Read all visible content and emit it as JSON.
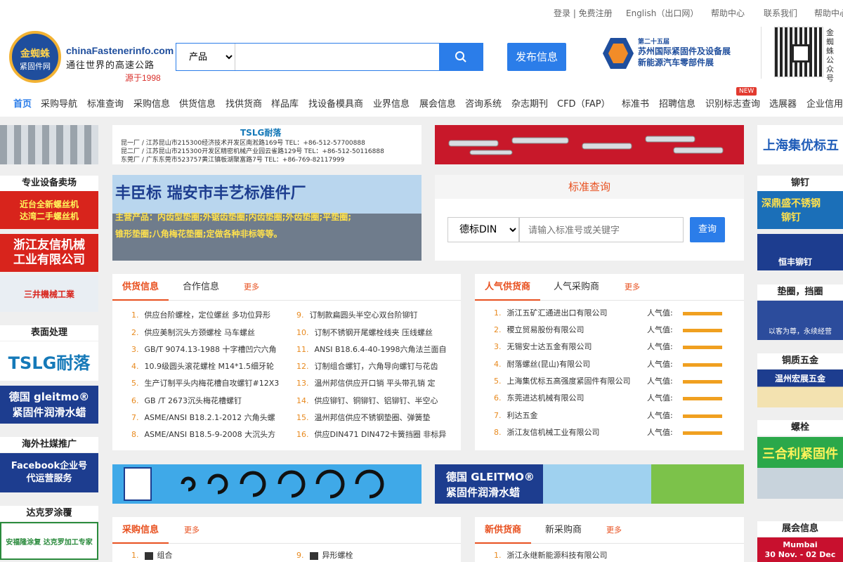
{
  "topbar": {
    "login": "登录 | 免费注册",
    "english": "English（出口网）",
    "help": "帮助中心",
    "contact": "联系我们",
    "help2": "帮助中心"
  },
  "logo": {
    "cn_name": "金蜘蛛",
    "cn_sub": "紧固件网",
    "domain": "chinaFastenerinfo.com",
    "slogan": "通往世界的高速公路",
    "since": "源于1998"
  },
  "search": {
    "category": "产品",
    "placeholder": ""
  },
  "publish_label": "发布信息",
  "expo": {
    "line1": "第二十五届",
    "line2": "苏州国际紧固件及设备展",
    "line3": "新能源汽车零部件展"
  },
  "qr_label": "金蜘蛛公众号",
  "nav": {
    "items": [
      "首页",
      "采购导航",
      "标准查询",
      "采购信息",
      "供货信息",
      "找供货商",
      "样品库",
      "找设备模具商",
      "业界信息",
      "展会信息",
      "咨询系统",
      "杂志期刊",
      "CFD（FAP）",
      "标准书",
      "招聘信息",
      "识别标志查询",
      "选展器",
      "企业信用"
    ],
    "new_badge": "NEW"
  },
  "left_sidebar": {
    "cat1": "专业设备卖场",
    "ad1": "近台全新螺丝机\n达湾二手螺丝机",
    "ad2": "浙江友信机械\n工业有限公司",
    "ad3": "三井機械工業",
    "cat2": "表面处理",
    "ad4": "TSLG耐落",
    "ad5": "德国 gleitmo®\n紧固件润滑水蜡",
    "cat3": "海外社媒推广",
    "ad6": "Facebook企业号\n代运营服务",
    "cat4": "达克罗涂覆",
    "ad7": "安福隆涂复 达克罗加工专家"
  },
  "right_sidebar": {
    "ad1": "上海集优标五",
    "cat1": "铆钉",
    "ad2": "深鼎盛不锈钢\n铆钉",
    "ad3": "恒丰铆钉",
    "cat2": "垫圈，挡圈",
    "ad4": "以客为尊，永续经营",
    "cat3": "铜质五金",
    "ad5": "温州宏展五金",
    "cat4": "螺栓",
    "ad6": "三合利紧固件",
    "cat5": "展会信息",
    "ad7": "Mumbai\n30 Nov. - 02 Dec"
  },
  "banner_tslg": {
    "brand": "TSLG耐落",
    "line1": "昆一厂 / 江苏昆山市215300经济技术开发区南淞路169号 TEL：+86-512-57700888",
    "line2": "昆二厂 / 江苏昆山市215300开发区精密机械产业园云雀路129号 TEL：+86-512-50116888",
    "line3": "东莞厂 / 广东东莞市523757黄江镇板湖聚富路7号 TEL：+86-769-82117999"
  },
  "banner_fengyi": {
    "title": "丰臣标  瑞安市丰艺标准件厂",
    "text": "主营产品：内齿型垫圈;外锯齿垫圈;内齿垫圈;外齿垫圈;平垫圈;锥形垫圈;八角梅花垫圈;定做各种非标等等。"
  },
  "std_query": {
    "title": "标准查询",
    "standard": "德标DIN",
    "placeholder": "请输入标准号或关键字",
    "button": "查询"
  },
  "supply_panel": {
    "tab1": "供货信息",
    "tab2": "合作信息",
    "more": "更多",
    "left": [
      {
        "n": "1.",
        "t": "供应台阶螺栓，定位螺丝 多功位异形"
      },
      {
        "n": "2.",
        "t": "供应美制沉头方颈螺栓 马车螺丝"
      },
      {
        "n": "3.",
        "t": "GB/T 9074.13-1988 十字槽凹穴六角"
      },
      {
        "n": "4.",
        "t": "10.9级圆头滚花螺栓 M14*1.5细牙轮"
      },
      {
        "n": "5.",
        "t": "生产订制平头内梅花槽自攻螺钉#12X3"
      },
      {
        "n": "6.",
        "t": "GB /T 2673沉头梅花槽螺钉"
      },
      {
        "n": "7.",
        "t": "ASME/ANSI B18.2.1-2012 六角头螺"
      },
      {
        "n": "8.",
        "t": "ASME/ANSI B18.5-9-2008 大沉头方"
      }
    ],
    "right": [
      {
        "n": "9.",
        "t": "订制款扁圆头半空心双台阶铆钉"
      },
      {
        "n": "10.",
        "t": "订制不锈钢开尾螺栓线夹 压线螺丝"
      },
      {
        "n": "11.",
        "t": "ANSI B18.6.4-40-1998六角法兰面自"
      },
      {
        "n": "12.",
        "t": "订制组合螺钉，六角导向螺钉与花齿"
      },
      {
        "n": "13.",
        "t": "温州邦信供应开口销 平头带孔销 定"
      },
      {
        "n": "14.",
        "t": "供应铆钉、铜铆钉、铝铆钉、半空心"
      },
      {
        "n": "15.",
        "t": "温州邦信供应不锈钢垫圈、弹簧垫"
      },
      {
        "n": "16.",
        "t": "供应DIN471 DIN472卡簧挡圈 非标异"
      }
    ]
  },
  "popular_panel": {
    "tab1": "人气供货商",
    "tab2": "人气采购商",
    "more": "更多",
    "pop_label": "人气值:",
    "items": [
      {
        "n": "1.",
        "t": "浙江五矿汇通进出口有限公司",
        "v": 1.0
      },
      {
        "n": "2.",
        "t": "稷立贸易股份有限公司",
        "v": 1.0
      },
      {
        "n": "3.",
        "t": "无锡安士达五金有限公司",
        "v": 1.0
      },
      {
        "n": "4.",
        "t": "耐落螺丝(昆山)有限公司",
        "v": 1.0
      },
      {
        "n": "5.",
        "t": "上海集优标五高强度紧固件有限公司",
        "v": 1.0
      },
      {
        "n": "6.",
        "t": "东莞进达机械有限公司",
        "v": 1.0
      },
      {
        "n": "7.",
        "t": "利达五金",
        "v": 1.0
      },
      {
        "n": "8.",
        "t": "浙江友信机械工业有限公司",
        "v": 1.0
      }
    ]
  },
  "banner_rings": "挡圈",
  "banner_gleitmo": {
    "l1": "德国 GLEITMO®",
    "l2": "紧固件润滑水蜡"
  },
  "purchase_panel": {
    "tab1": "采购信息",
    "more": "更多",
    "i1n": "1.",
    "i1": "组合",
    "i9n": "9.",
    "i9": "异形螺栓"
  },
  "new_panel": {
    "tab1": "新供货商",
    "tab2": "新采购商",
    "more": "更多",
    "i1n": "1.",
    "i1": "浙江永继新能源科技有限公司"
  }
}
